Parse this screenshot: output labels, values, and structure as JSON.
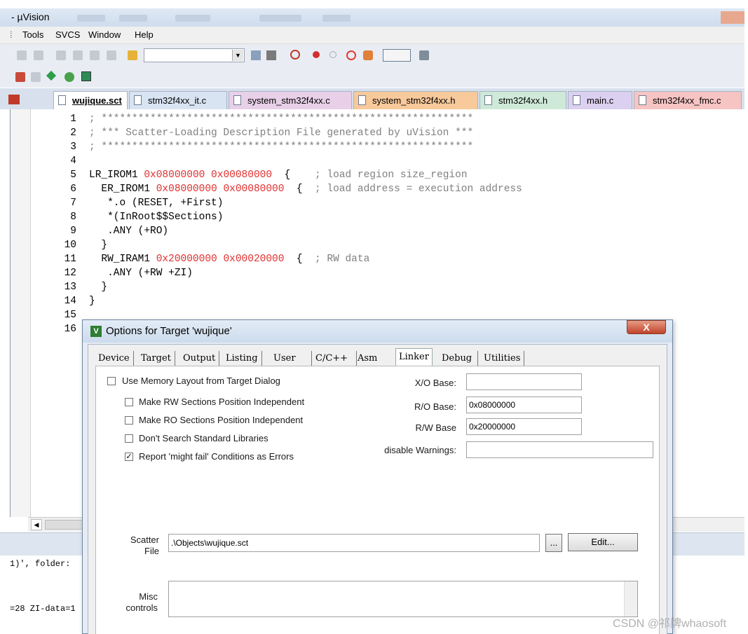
{
  "window": {
    "title": "- µVision"
  },
  "menu": [
    "Tools",
    "SVCS",
    "Window",
    "Help"
  ],
  "tabs": [
    {
      "label": "wujique.sct",
      "color": "#ffffff",
      "active": true
    },
    {
      "label": "stm32f4xx_it.c",
      "color": "#d8e4f2",
      "active": false
    },
    {
      "label": "system_stm32f4xx.c",
      "color": "#e8d0e8",
      "active": false
    },
    {
      "label": "system_stm32f4xx.h",
      "color": "#f7c99b",
      "active": false
    },
    {
      "label": "stm32f4xx.h",
      "color": "#cfe9d8",
      "active": false
    },
    {
      "label": "main.c",
      "color": "#dcd0f0",
      "active": false
    },
    {
      "label": "stm32f4xx_fmc.c",
      "color": "#f7c4c4",
      "active": false
    }
  ],
  "code": [
    {
      "n": "1",
      "t": "; *************************************************************"
    },
    {
      "n": "2",
      "t": "; *** Scatter-Loading Description File generated by uVision ***"
    },
    {
      "n": "3",
      "t": "; *************************************************************"
    },
    {
      "n": "4",
      "t": ""
    },
    {
      "n": "5",
      "t": "LR_IROM1 0x08000000 0x00080000  {    ; load region size_region"
    },
    {
      "n": "6",
      "t": "  ER_IROM1 0x08000000 0x00080000  {  ; load address = execution address"
    },
    {
      "n": "7",
      "t": "   *.o (RESET, +First)"
    },
    {
      "n": "8",
      "t": "   *(InRoot$$Sections)"
    },
    {
      "n": "9",
      "t": "   .ANY (+RO)"
    },
    {
      "n": "10",
      "t": "  }"
    },
    {
      "n": "11",
      "t": "  RW_IRAM1 0x20000000 0x00020000  {  ; RW data"
    },
    {
      "n": "12",
      "t": "   .ANY (+RW +ZI)"
    },
    {
      "n": "13",
      "t": "  }"
    },
    {
      "n": "14",
      "t": "}"
    },
    {
      "n": "15",
      "t": ""
    },
    {
      "n": "16",
      "t": ""
    }
  ],
  "output": {
    "line1": "1)', folder:",
    "line2": "=28 ZI-data=1"
  },
  "dialog": {
    "title": "Options for Target 'wujique'",
    "close": "X",
    "tabs": [
      "Device",
      "Target",
      "Output",
      "Listing",
      "User",
      "C/C++",
      "Asm",
      "Linker",
      "Debug",
      "Utilities"
    ],
    "active_tab": "Linker",
    "checks": [
      {
        "label": "Use Memory Layout from Target Dialog",
        "checked": false
      },
      {
        "label": "Make RW Sections Position Independent",
        "checked": false
      },
      {
        "label": "Make RO Sections Position Independent",
        "checked": false
      },
      {
        "label": "Don't Search Standard Libraries",
        "checked": false
      },
      {
        "label": "Report 'might fail' Conditions as Errors",
        "checked": true
      }
    ],
    "fields": {
      "xo_label": "X/O Base:",
      "xo_value": "",
      "ro_label": "R/O Base:",
      "ro_value": "0x08000000",
      "rw_label": "R/W Base",
      "rw_value": "0x20000000",
      "warn_label": "disable Warnings:",
      "warn_value": ""
    },
    "scatter_label_1": "Scatter",
    "scatter_label_2": "File",
    "scatter_value": ".\\Objects\\wujique.sct",
    "browse": "...",
    "edit": "Edit...",
    "misc_label_1": "Misc",
    "misc_label_2": "controls",
    "check_mark": "✓"
  },
  "watermark": "CSDN @祁牌whaosoft"
}
